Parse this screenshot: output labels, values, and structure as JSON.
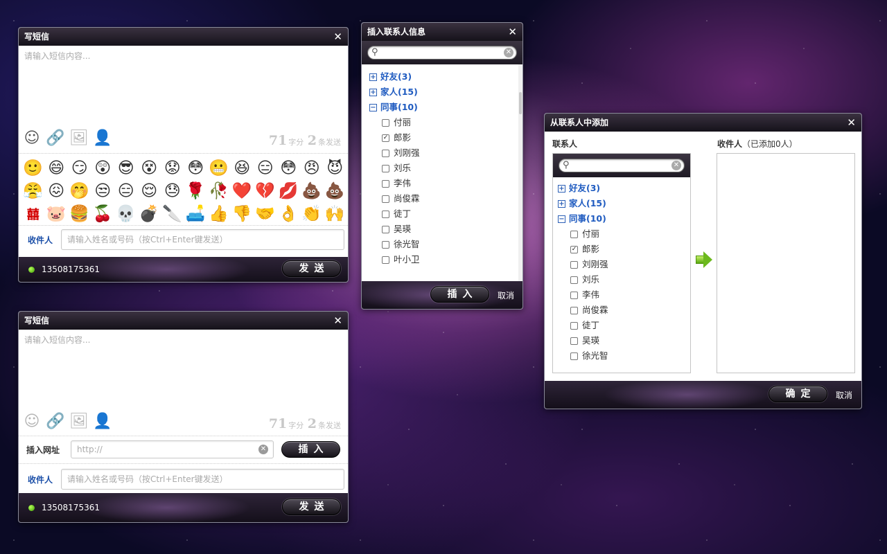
{
  "colors": {
    "accent_blue": "#1b4fa8",
    "online_green": "#5ec400",
    "title_bar": "#1c1822"
  },
  "sms1": {
    "title": "写短信",
    "placeholder": "请输入短信内容...",
    "counter": {
      "chars": "71",
      "chars_unit": "字分",
      "msgs": "2",
      "msgs_unit": "条发送"
    },
    "emoji_rows": [
      [
        "🙂",
        "😄",
        "😏",
        "😲",
        "😎",
        "😵",
        "😟",
        "😳",
        "😬",
        "😆",
        "😑",
        "😳",
        "😠",
        "😈"
      ],
      [
        "😤",
        "😖",
        "🤭",
        "😒",
        "😑",
        "😌",
        "😓",
        "🌹",
        "🥀",
        "❤️",
        "💔",
        "💋",
        "💩",
        "💩"
      ],
      [
        "囍",
        "🐷",
        "🍔",
        "🍒",
        "💀",
        "💣",
        "🔪",
        "🛋️",
        "👍",
        "👎",
        "🤝",
        "👌",
        "👏",
        "🙌"
      ]
    ],
    "recipient_label": "收件人",
    "recipient_placeholder": "请输入姓名或号码（按Ctrl+Enter键发送）",
    "phone": "13508175361",
    "send_label": "发送"
  },
  "sms2": {
    "title": "写短信",
    "placeholder": "请输入短信内容...",
    "counter": {
      "chars": "71",
      "chars_unit": "字分",
      "msgs": "2",
      "msgs_unit": "条发送"
    },
    "url_label": "插入网址",
    "url_placeholder": "http://",
    "insert_label": "插入",
    "recipient_label": "收件人",
    "recipient_placeholder": "请输入姓名或号码（按Ctrl+Enter键发送）",
    "phone": "13508175361",
    "send_label": "发送"
  },
  "insert_contact": {
    "title": "插入联系人信息",
    "groups": [
      {
        "label": "好友(3)",
        "expanded": false
      },
      {
        "label": "家人(15)",
        "expanded": false
      },
      {
        "label": "同事(10)",
        "expanded": true
      }
    ],
    "members": [
      {
        "name": "付丽",
        "checked": false
      },
      {
        "name": "郎影",
        "checked": true
      },
      {
        "name": "刘刚强",
        "checked": false
      },
      {
        "name": "刘乐",
        "checked": false
      },
      {
        "name": "李伟",
        "checked": false
      },
      {
        "name": "尚俊霖",
        "checked": false
      },
      {
        "name": "徒丁",
        "checked": false
      },
      {
        "name": "吴瑛",
        "checked": false
      },
      {
        "name": "徐光智",
        "checked": false
      },
      {
        "name": "叶小卫",
        "checked": false
      }
    ],
    "insert_label": "插入",
    "cancel_label": "取消"
  },
  "add_from_contacts": {
    "title": "从联系人中添加",
    "contacts_label": "联系人",
    "recipients_label": "收件人",
    "recipients_count": "（已添加0人）",
    "groups": [
      {
        "label": "好友(3)",
        "expanded": false
      },
      {
        "label": "家人(15)",
        "expanded": false
      },
      {
        "label": "同事(10)",
        "expanded": true
      }
    ],
    "members": [
      {
        "name": "付丽",
        "checked": false
      },
      {
        "name": "郎影",
        "checked": true
      },
      {
        "name": "刘刚强",
        "checked": false
      },
      {
        "name": "刘乐",
        "checked": false
      },
      {
        "name": "李伟",
        "checked": false
      },
      {
        "name": "尚俊霖",
        "checked": false
      },
      {
        "name": "徒丁",
        "checked": false
      },
      {
        "name": "吴瑛",
        "checked": false
      },
      {
        "name": "徐光智",
        "checked": false
      }
    ],
    "confirm_label": "确定",
    "cancel_label": "取消"
  }
}
